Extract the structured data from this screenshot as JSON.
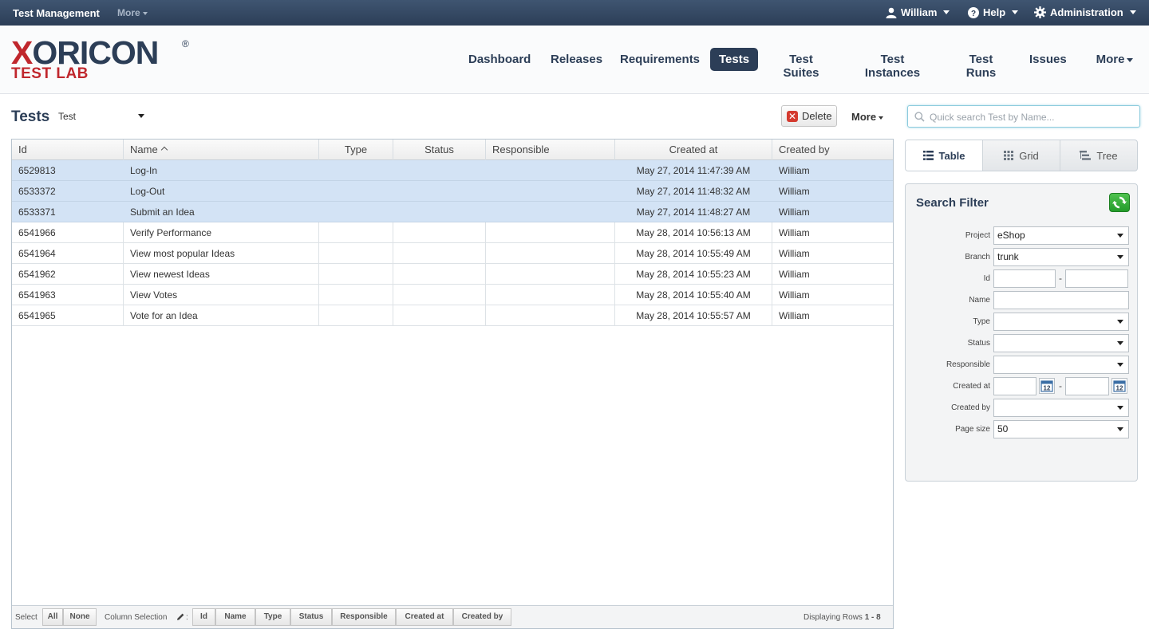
{
  "topbar": {
    "app_title": "Test Management",
    "more": "More",
    "user": "William",
    "help": "Help",
    "admin": "Administration"
  },
  "logo": {
    "line1_x": "X",
    "line1_rest": "ORICON",
    "registered": "®",
    "line2": "TEST LAB"
  },
  "nav": [
    {
      "label": "Dashboard"
    },
    {
      "label": "Releases"
    },
    {
      "label": "Requirements"
    },
    {
      "label": "Tests",
      "active": true
    },
    {
      "label": "Test Suites"
    },
    {
      "label": "Test Instances"
    },
    {
      "label": "Test Runs"
    },
    {
      "label": "Issues"
    },
    {
      "label": "More"
    }
  ],
  "page": {
    "title": "Tests",
    "type_select": "Test",
    "delete_label": "Delete",
    "more_label": "More"
  },
  "table": {
    "columns": [
      "Id",
      "Name",
      "Type",
      "Status",
      "Responsible",
      "Created at",
      "Created by"
    ],
    "rows": [
      {
        "id": "6529813",
        "name": "Log-In",
        "type": "",
        "status": "",
        "responsible": "",
        "created_at": "May 27, 2014 11:47:39 AM",
        "created_by": "William",
        "selected": true
      },
      {
        "id": "6533372",
        "name": "Log-Out",
        "type": "",
        "status": "",
        "responsible": "",
        "created_at": "May 27, 2014 11:48:32 AM",
        "created_by": "William",
        "selected": true
      },
      {
        "id": "6533371",
        "name": "Submit an Idea",
        "type": "",
        "status": "",
        "responsible": "",
        "created_at": "May 27, 2014 11:48:27 AM",
        "created_by": "William",
        "selected": true
      },
      {
        "id": "6541966",
        "name": "Verify Performance",
        "type": "",
        "status": "",
        "responsible": "",
        "created_at": "May 28, 2014 10:56:13 AM",
        "created_by": "William",
        "selected": false
      },
      {
        "id": "6541964",
        "name": "View most popular Ideas",
        "type": "",
        "status": "",
        "responsible": "",
        "created_at": "May 28, 2014 10:55:49 AM",
        "created_by": "William",
        "selected": false
      },
      {
        "id": "6541962",
        "name": "View newest Ideas",
        "type": "",
        "status": "",
        "responsible": "",
        "created_at": "May 28, 2014 10:55:23 AM",
        "created_by": "William",
        "selected": false
      },
      {
        "id": "6541963",
        "name": "View Votes",
        "type": "",
        "status": "",
        "responsible": "",
        "created_at": "May 28, 2014 10:55:40 AM",
        "created_by": "William",
        "selected": false
      },
      {
        "id": "6541965",
        "name": "Vote for an Idea",
        "type": "",
        "status": "",
        "responsible": "",
        "created_at": "May 28, 2014 10:55:57 AM",
        "created_by": "William",
        "selected": false
      }
    ]
  },
  "footer": {
    "select_label": "Select",
    "all": "All",
    "none": "None",
    "column_selection_label": "Column Selection",
    "colon": ":",
    "column_buttons": [
      "Id",
      "Name",
      "Type",
      "Status",
      "Responsible",
      "Created at",
      "Created by"
    ],
    "displaying_label": "Displaying Rows",
    "displaying_range": "1 - 8"
  },
  "search": {
    "placeholder": "Quick search Test by Name..."
  },
  "view_tabs": [
    {
      "label": "Table",
      "icon": "list-icon",
      "active": true
    },
    {
      "label": "Grid",
      "icon": "grid-icon"
    },
    {
      "label": "Tree",
      "icon": "tree-icon"
    }
  ],
  "filter": {
    "title": "Search Filter",
    "project_label": "Project",
    "project_value": "eShop",
    "branch_label": "Branch",
    "branch_value": "trunk",
    "id_label": "Id",
    "name_label": "Name",
    "type_label": "Type",
    "status_label": "Status",
    "responsible_label": "Responsible",
    "created_at_label": "Created at",
    "created_by_label": "Created by",
    "page_size_label": "Page size",
    "page_size_value": "50",
    "dash": "-"
  },
  "colors": {
    "navy": "#2c3e57",
    "brand_red": "#c0272d",
    "selected_row": "#d3e3f5",
    "refresh_green": "#2fae35"
  }
}
